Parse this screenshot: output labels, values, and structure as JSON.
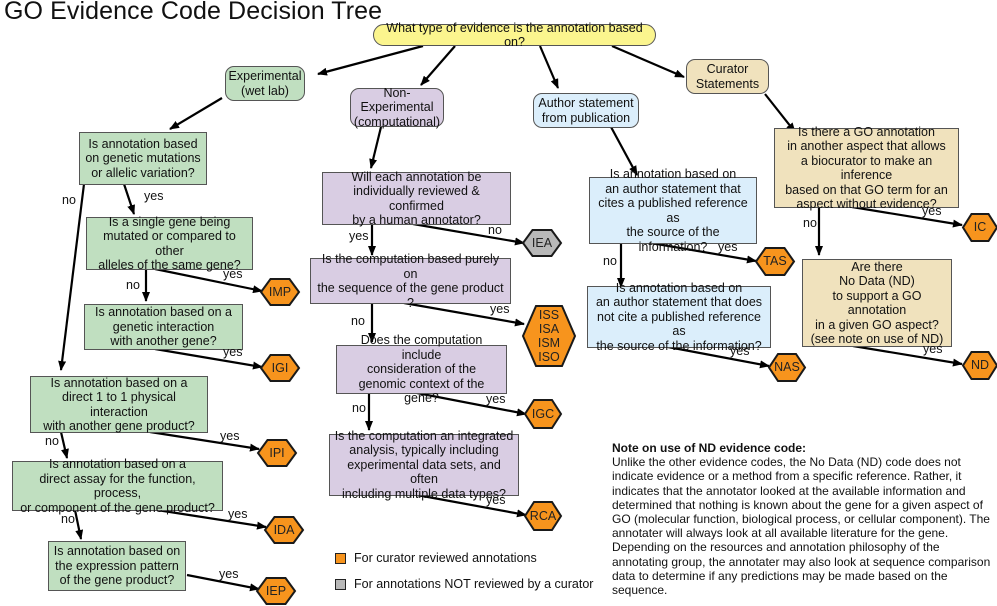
{
  "title": "GO Evidence Code Decision Tree",
  "root": {
    "text": "What type of evidence is the annotation based on?"
  },
  "categories": [
    {
      "id": "experimental",
      "text": "Experimental\n(wet lab)",
      "color": "#c0dfc0"
    },
    {
      "id": "non_experimental",
      "text": "Non-Experimental\n(computational)",
      "color": "#d9cde3"
    },
    {
      "id": "author",
      "text": "Author statement\nfrom publication",
      "color": "#dbeefb"
    },
    {
      "id": "curator",
      "text": "Curator\nStatements",
      "color": "#f0e2bd"
    }
  ],
  "questions": {
    "exp1": "Is annotation based\non genetic mutations\nor allelic variation?",
    "exp2": "Is a single gene being\nmutated or compared to other\nalleles of the same gene?",
    "exp3": "Is annotation based on a\ngenetic interaction\nwith another gene?",
    "exp4": "Is annotation based on a\ndirect 1 to 1 physical interaction\nwith another gene product?",
    "exp5": "Is annotation based on a\ndirect assay for the function, process,\nor component of the  gene product?",
    "exp6": "Is annotation based on\nthe expression pattern\nof the  gene product?",
    "comp1": "Will each annotation be\nindividually reviewed & confirmed\nby a human annotator?",
    "comp2": "Is the computation based purely on\nthe sequence of the gene product ?",
    "comp3": "Does the computation include\nconsideration of the\ngenomic context of the gene?",
    "comp4": "Is the computation an integrated\nanalysis, typically including\nexperimental data sets, and often\nincluding multiple data types?",
    "auth1": "Is annotation based on\nan author statement that\ncites a published reference as\nthe source of the information?",
    "auth2": "Is annotation based on\nan author statement that does\nnot cite a published reference as\nthe source of the information?",
    "cur1": "Is there a GO annotation\nin another aspect that allows\na biocurator to make an inference\nbased on that GO term for an\naspect without evidence?",
    "cur2": "Are there\nNo Data (ND)\nto support a GO annotation\nin a given GO aspect?\n(see note on use of ND)"
  },
  "codes": {
    "IMP": "IMP",
    "IGI": "IGI",
    "IPI": "IPI",
    "IDA": "IDA",
    "IEP": "IEP",
    "IEA": "IEA",
    "ISS": "ISS\nISA\nISM\nISO",
    "IGC": "IGC",
    "RCA": "RCA",
    "TAS": "TAS",
    "NAS": "NAS",
    "IC": "IC",
    "ND": "ND"
  },
  "edge_labels": {
    "yes": "yes",
    "no": "no"
  },
  "colors": {
    "reviewed": "#f7941d",
    "not_reviewed": "#b8b8b8",
    "hex_border": "#1a1a1a"
  },
  "legend": [
    {
      "label": "For curator reviewed annotations",
      "color": "#f7941d"
    },
    {
      "label": "For annotations NOT reviewed by a curator",
      "color": "#b8b8b8"
    }
  ],
  "note": {
    "title": "Note on use of ND evidence code:",
    "body": "Unlike the other evidence codes, the No Data (ND) code does not indicate evidence or a method from a specific reference. Rather, it indicates that the annotator looked at the available information and determined that nothing is known about the gene for a given aspect of GO (molecular function, biological process, or cellular component). The annotater will always look at all available literature for the gene. Depending on the resources and annotation philosophy of the annotating group, the annotater may also look at sequence comparison data to determine if any predictions may be made based on the sequence."
  }
}
